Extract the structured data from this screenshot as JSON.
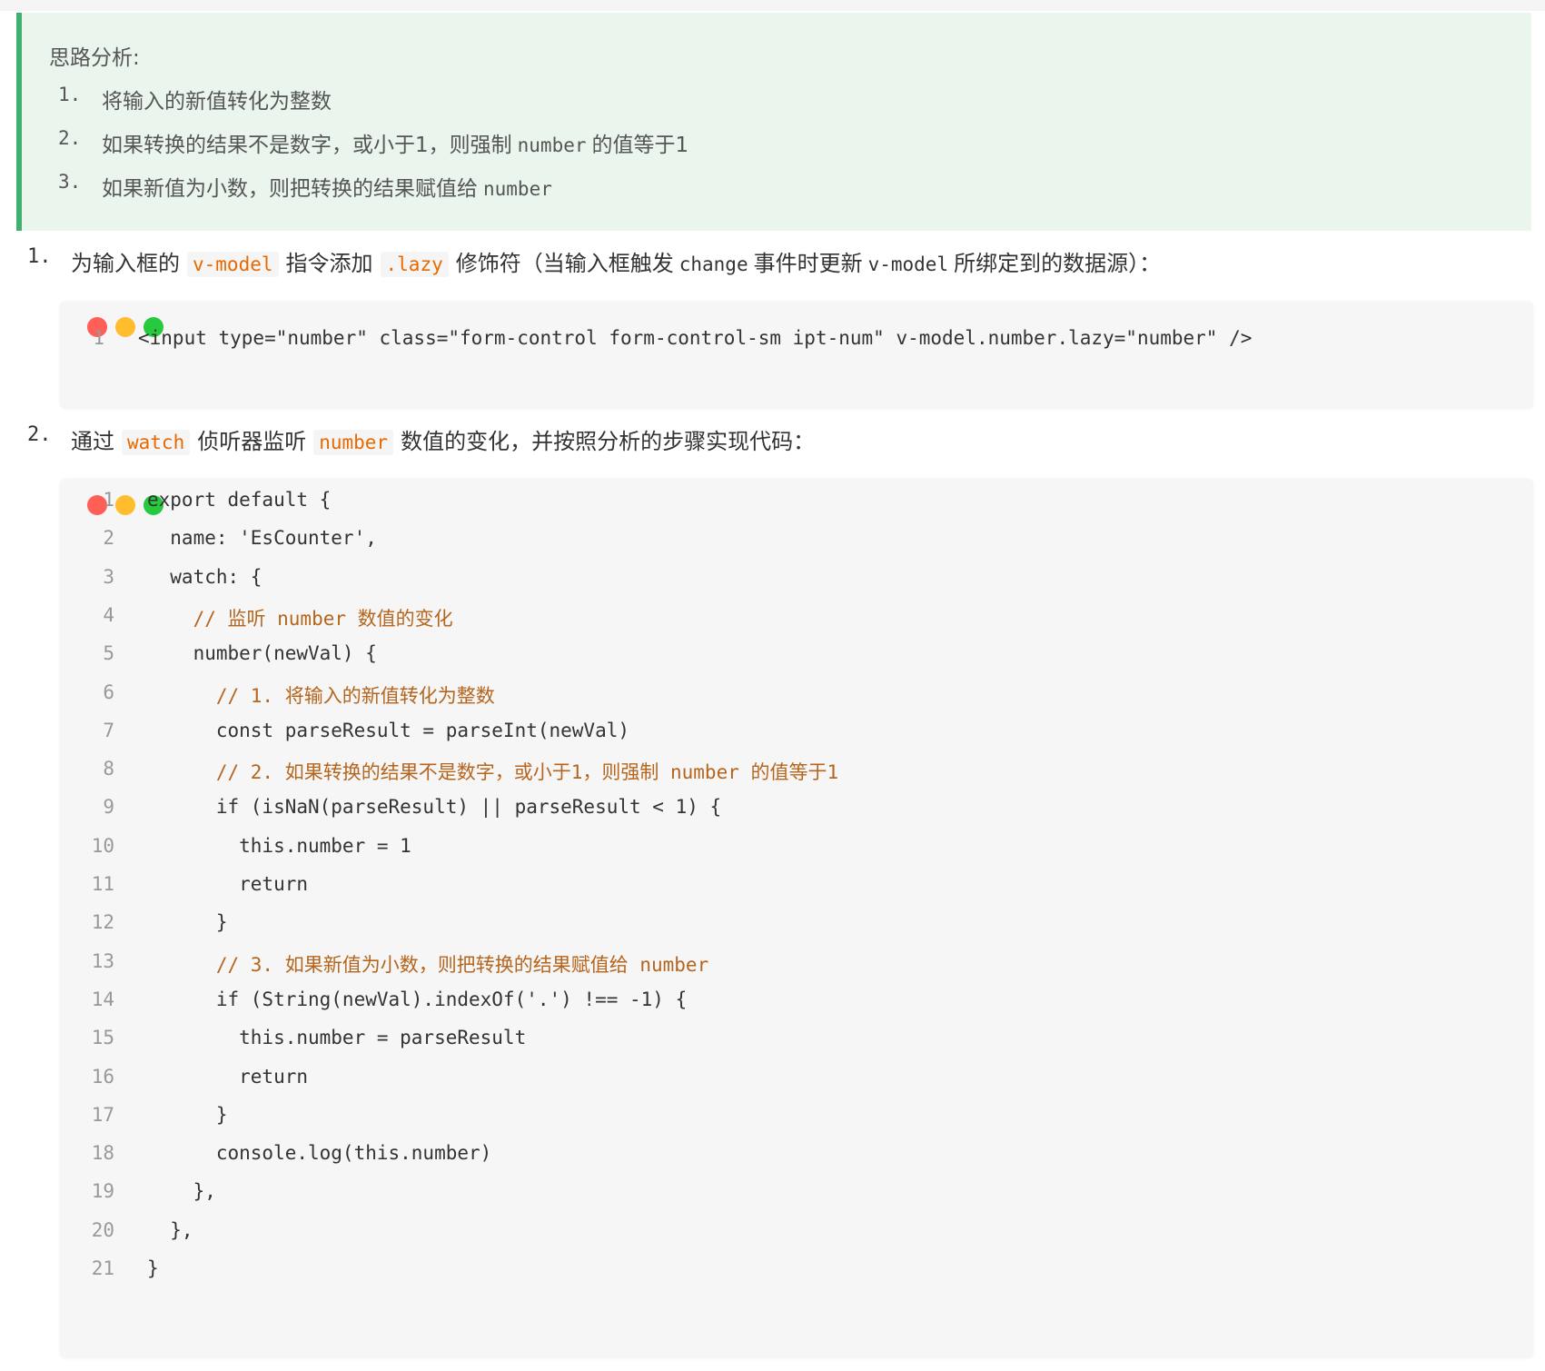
{
  "tip": {
    "title": "思路分析:",
    "items": [
      {
        "num": "1.",
        "text": "将输入的新值转化为整数"
      },
      {
        "num": "2.",
        "pre": "如果转换的结果不是数字，或小于1，则强制",
        "code": "number",
        "post": "的值等于1"
      },
      {
        "num": "3.",
        "pre": "如果新值为小数，则把转换的结果赋值给",
        "code": "number"
      }
    ]
  },
  "step1": {
    "num": "1.",
    "t1": "为输入框的",
    "c1": "v-model",
    "t2": "指令添加",
    "c2": ".lazy",
    "t3": "修饰符（当输入框触发",
    "c3": "change",
    "t4": "事件时更新",
    "c4": "v-model",
    "t5": "所绑定到的数据源）："
  },
  "code1": {
    "lines": [
      {
        "n": "1",
        "text": "<input type=\"number\" class=\"form-control form-control-sm ipt-num\" v-model.number.lazy=\"number\" />"
      }
    ]
  },
  "step2": {
    "num": "2.",
    "t1": "通过",
    "c1": "watch",
    "t2": "侦听器监听",
    "c2": "number",
    "t3": "数值的变化，并按照分析的步骤实现代码："
  },
  "code2": {
    "lines": [
      {
        "n": "1",
        "text": "export default {"
      },
      {
        "n": "2",
        "text": "  name: 'EsCounter',"
      },
      {
        "n": "3",
        "text": "  watch: {"
      },
      {
        "n": "4",
        "text": "    // 监听 number 数值的变化"
      },
      {
        "n": "5",
        "text": "    number(newVal) {"
      },
      {
        "n": "6",
        "text": "      // 1. 将输入的新值转化为整数"
      },
      {
        "n": "7",
        "text": "      const parseResult = parseInt(newVal)"
      },
      {
        "n": "8",
        "text": "      // 2. 如果转换的结果不是数字，或小于1，则强制 number 的值等于1"
      },
      {
        "n": "9",
        "text": "      if (isNaN(parseResult) || parseResult < 1) {"
      },
      {
        "n": "10",
        "text": "        this.number = 1"
      },
      {
        "n": "11",
        "text": "        return"
      },
      {
        "n": "12",
        "text": "      }"
      },
      {
        "n": "13",
        "text": "      // 3. 如果新值为小数，则把转换的结果赋值给 number"
      },
      {
        "n": "14",
        "text": "      if (String(newVal).indexOf('.') !== -1) {"
      },
      {
        "n": "15",
        "text": "        this.number = parseResult"
      },
      {
        "n": "16",
        "text": "        return"
      },
      {
        "n": "17",
        "text": "      }"
      },
      {
        "n": "18",
        "text": "      console.log(this.number)"
      },
      {
        "n": "19",
        "text": "    },"
      },
      {
        "n": "20",
        "text": "  },"
      },
      {
        "n": "21",
        "text": "}"
      }
    ]
  },
  "colors": {
    "accent": "#3fb06d",
    "tip_bg": "#eaf5ee",
    "chip": "#e96900",
    "code_bg": "#f6f6f6"
  }
}
